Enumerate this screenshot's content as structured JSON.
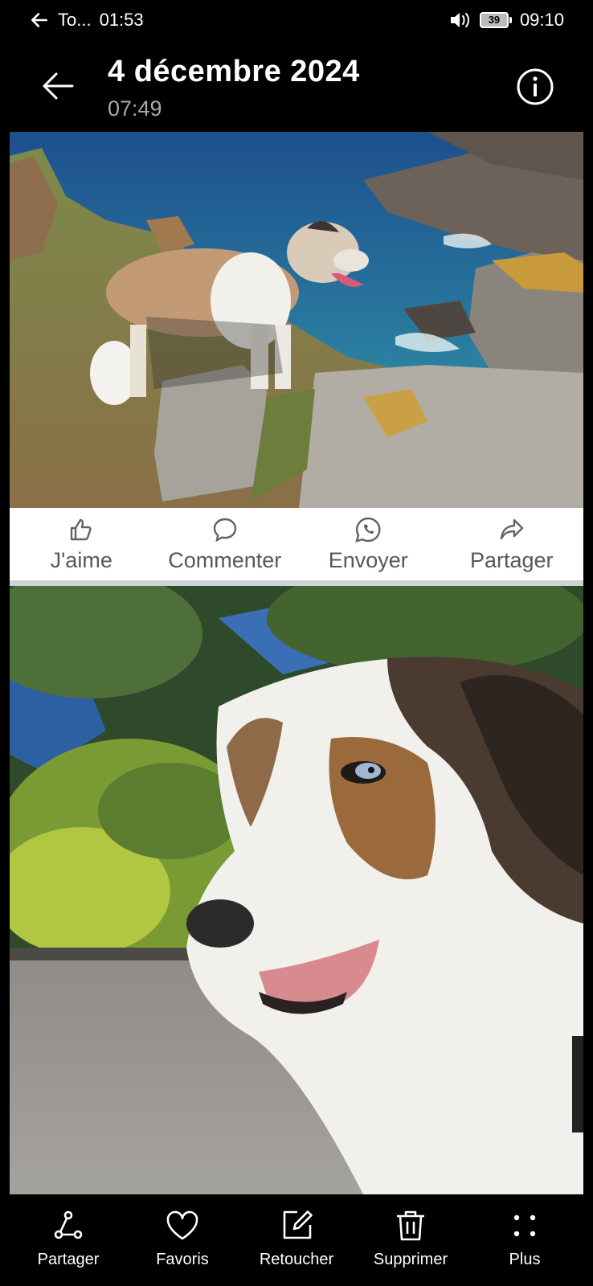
{
  "status_bar": {
    "app_name": "To...",
    "call_time": "01:53",
    "battery_level": "39",
    "clock": "09:10"
  },
  "header": {
    "date": "4 décembre 2024",
    "time": "07:49"
  },
  "post_actions": [
    {
      "label": "J'aime",
      "icon": "thumbs-up-icon"
    },
    {
      "label": "Commenter",
      "icon": "comment-icon"
    },
    {
      "label": "Envoyer",
      "icon": "whatsapp-icon"
    },
    {
      "label": "Partager",
      "icon": "share-arrow-icon"
    }
  ],
  "toolbar": {
    "share": "Partager",
    "favorites": "Favoris",
    "edit": "Retoucher",
    "delete": "Supprimer",
    "more": "Plus"
  },
  "colors": {
    "background": "#000000",
    "action_text": "#55585c",
    "divider": "#cfd2d6"
  }
}
